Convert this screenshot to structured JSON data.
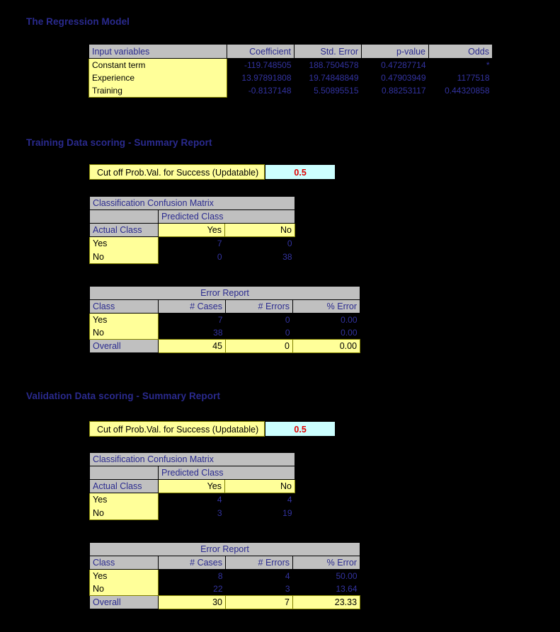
{
  "sections": {
    "regression_title": "The Regression Model",
    "training_title": "Training Data scoring - Summary Report",
    "validation_title": "Validation Data scoring - Summary Report"
  },
  "colors": {
    "background": "#000000",
    "header_grey": "#c0c0c0",
    "cell_yellow": "#ffff99",
    "cutoff_cyan": "#ccffff",
    "text_blue": "#2a2a8e",
    "value_blue": "#3333a0",
    "cutoff_red": "#e00000"
  },
  "regression": {
    "headers": [
      "Input variables",
      "Coefficient",
      "Std. Error",
      "p-value",
      "Odds"
    ],
    "rows": [
      {
        "variable": "Constant term",
        "coefficient": "-119.748505",
        "std_error": "188.7504578",
        "p_value": "0.47287714",
        "odds": "*"
      },
      {
        "variable": "Experience",
        "coefficient": "13.97891808",
        "std_error": "19.74848849",
        "p_value": "0.47903949",
        "odds": "1177518"
      },
      {
        "variable": "Training",
        "coefficient": "-0.8137148",
        "std_error": "5.50895515",
        "p_value": "0.88253117",
        "odds": "0.44320858"
      }
    ]
  },
  "training": {
    "cutoff": {
      "label": "Cut off Prob.Val. for Success (Updatable)",
      "value": "0.5"
    },
    "confusion": {
      "title": "Classification Confusion Matrix",
      "predicted_header": "Predicted Class",
      "actual_header": "Actual Class",
      "class_labels": [
        "Yes",
        "No"
      ],
      "rows": [
        {
          "label": "Yes",
          "values": [
            "7",
            "0"
          ]
        },
        {
          "label": "No",
          "values": [
            "0",
            "38"
          ]
        }
      ]
    },
    "error_report": {
      "title": "Error Report",
      "headers": [
        "Class",
        "# Cases",
        "# Errors",
        "% Error"
      ],
      "rows": [
        {
          "label": "Yes",
          "cases": "7",
          "errors": "0",
          "pct": "0.00"
        },
        {
          "label": "No",
          "cases": "38",
          "errors": "0",
          "pct": "0.00"
        }
      ],
      "overall": {
        "label": "Overall",
        "cases": "45",
        "errors": "0",
        "pct": "0.00"
      }
    }
  },
  "validation": {
    "cutoff": {
      "label": "Cut off Prob.Val. for Success (Updatable)",
      "value": "0.5"
    },
    "confusion": {
      "title": "Classification Confusion Matrix",
      "predicted_header": "Predicted Class",
      "actual_header": "Actual Class",
      "class_labels": [
        "Yes",
        "No"
      ],
      "rows": [
        {
          "label": "Yes",
          "values": [
            "4",
            "4"
          ]
        },
        {
          "label": "No",
          "values": [
            "3",
            "19"
          ]
        }
      ]
    },
    "error_report": {
      "title": "Error Report",
      "headers": [
        "Class",
        "# Cases",
        "# Errors",
        "% Error"
      ],
      "rows": [
        {
          "label": "Yes",
          "cases": "8",
          "errors": "4",
          "pct": "50.00"
        },
        {
          "label": "No",
          "cases": "22",
          "errors": "3",
          "pct": "13.64"
        }
      ],
      "overall": {
        "label": "Overall",
        "cases": "30",
        "errors": "7",
        "pct": "23.33"
      }
    }
  }
}
